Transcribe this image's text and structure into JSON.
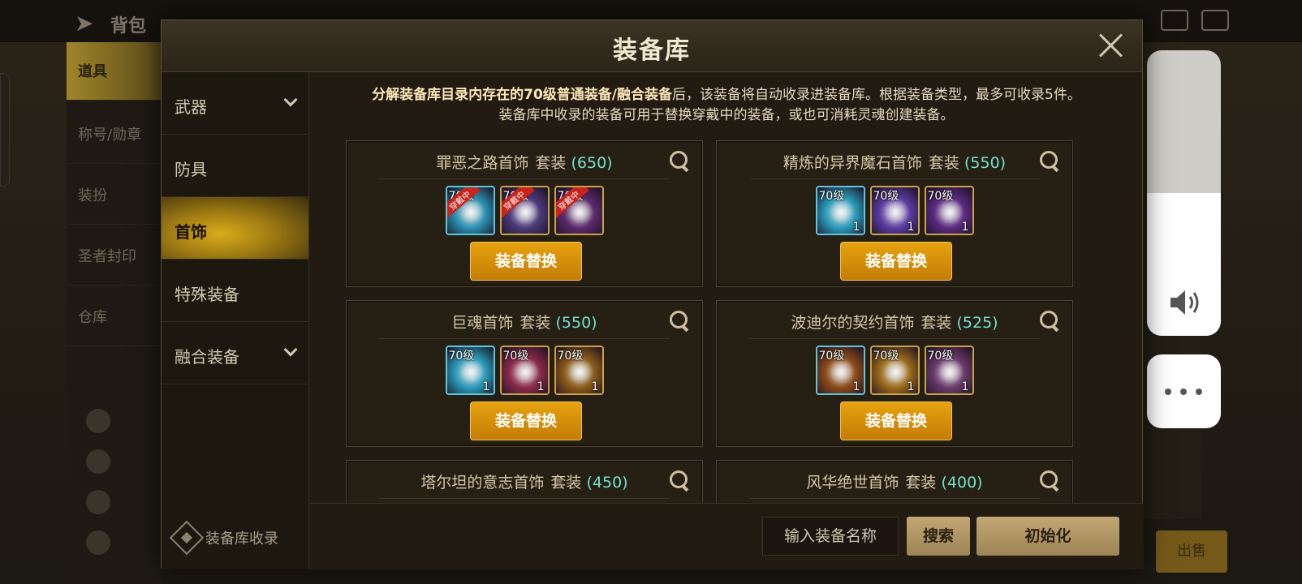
{
  "background": {
    "back_label": "背包",
    "sidebar": [
      "道具",
      "称号/勋章",
      "装扮",
      "圣者封印",
      "仓库"
    ],
    "sell_label": "出售"
  },
  "modal": {
    "title": "装备库",
    "description_line1_pre": "分解装备库目录内存在的70级普通装备/融合装备",
    "description_line1_post": "后，该装备将自动收录进装备库。根据装备类型，最多可收录5件。",
    "description_line2": "装备库中收录的装备可用于替换穿戴中的装备，或也可消耗灵魂创建装备。",
    "categories": [
      {
        "label": "武器",
        "has_chevron": true
      },
      {
        "label": "防具",
        "has_chevron": false
      },
      {
        "label": "首饰",
        "has_chevron": false,
        "active": true
      },
      {
        "label": "特殊装备",
        "has_chevron": false
      },
      {
        "label": "融合装备",
        "has_chevron": true
      }
    ],
    "collect_label": "装备库收录",
    "set_label": "套装",
    "replace_label": "装备替换",
    "cards": [
      {
        "name": "罪恶之路首饰",
        "score": "(650)",
        "items": [
          {
            "lvl": "70级",
            "cnt": "",
            "tag": "穿戴中",
            "color": "#2a8fb0"
          },
          {
            "lvl": "70级",
            "cnt": "",
            "tag": "穿戴中",
            "color": "#4a3a7a"
          },
          {
            "lvl": "70级",
            "cnt": "",
            "tag": "穿戴中",
            "color": "#5a2a6a"
          }
        ]
      },
      {
        "name": "精炼的异界魔石首饰",
        "score": "(550)",
        "items": [
          {
            "lvl": "70级",
            "cnt": "1",
            "tag": "",
            "color": "#2a9ab8"
          },
          {
            "lvl": "70级",
            "cnt": "1",
            "tag": "",
            "color": "#5a3aa0"
          },
          {
            "lvl": "70级",
            "cnt": "1",
            "tag": "",
            "color": "#5a2a80"
          }
        ]
      },
      {
        "name": "巨魂首饰",
        "score": "(550)",
        "items": [
          {
            "lvl": "70级",
            "cnt": "1",
            "tag": "",
            "color": "#2a9ab8"
          },
          {
            "lvl": "70级",
            "cnt": "1",
            "tag": "",
            "color": "#8a2a4a"
          },
          {
            "lvl": "70级",
            "cnt": "1",
            "tag": "",
            "color": "#8a5a1a"
          }
        ]
      },
      {
        "name": "波迪尔的契约首饰",
        "score": "(525)",
        "items": [
          {
            "lvl": "70级",
            "cnt": "1",
            "tag": "",
            "color": "#8a4a1a"
          },
          {
            "lvl": "70级",
            "cnt": "1",
            "tag": "",
            "color": "#9a6a1a"
          },
          {
            "lvl": "70级",
            "cnt": "1",
            "tag": "",
            "color": "#6a3a6a"
          }
        ]
      },
      {
        "name": "塔尔坦的意志首饰",
        "score": "(450)",
        "items": []
      },
      {
        "name": "风华绝世首饰",
        "score": "(400)",
        "items": []
      }
    ],
    "search_placeholder": "输入装备名称",
    "search_label": "搜索",
    "reset_label": "初始化"
  },
  "colors": {
    "accent": "#e6a20e",
    "score": "#74e2d2"
  }
}
